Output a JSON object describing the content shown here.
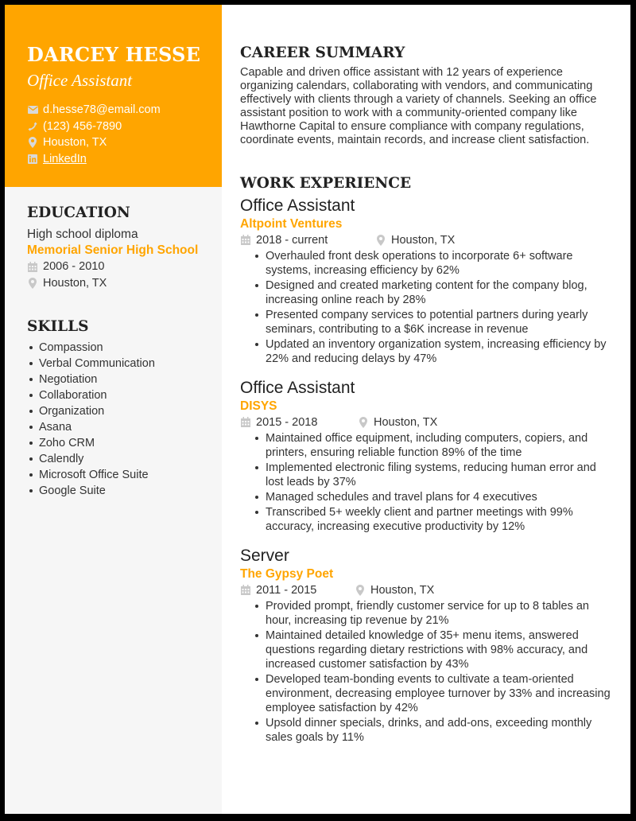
{
  "header": {
    "name": "DARCEY HESSE",
    "role": "Office Assistant",
    "contacts": {
      "email": "d.hesse78@email.com",
      "phone": "(123) 456-7890",
      "location": "Houston, TX",
      "linkedin": "LinkedIn"
    },
    "icons": [
      "envelope-icon",
      "phone-icon",
      "map-pin-icon",
      "linkedin-icon"
    ]
  },
  "colors": {
    "accent": "#ffa500",
    "sidebar_bg": "#f6f6f6",
    "text": "#333333",
    "heading": "#222222",
    "icon_gray": "#c8c8c8"
  },
  "education": {
    "title": "EDUCATION",
    "degree": "High school diploma",
    "school": "Memorial Senior High School",
    "dates": "2006 - 2010",
    "location": "Houston, TX"
  },
  "skills": {
    "title": "SKILLS",
    "items": [
      "Compassion",
      "Verbal Communication",
      "Negotiation",
      "Collaboration",
      "Organization",
      "Asana",
      "Zoho CRM",
      "Calendly",
      "Microsoft Office Suite",
      "Google Suite"
    ]
  },
  "summary": {
    "title": "CAREER SUMMARY",
    "text": "Capable and driven office assistant with 12 years of experience organizing calendars, collaborating with vendors, and communicating effectively with clients through a variety of channels. Seeking an office assistant position to work with a community-oriented company like Hawthorne Capital to ensure compliance with company regulations, coordinate events, maintain records, and increase client satisfaction."
  },
  "experience": {
    "title": "WORK EXPERIENCE",
    "jobs": [
      {
        "title": "Office Assistant",
        "company": "Altpoint Ventures",
        "dates": "2018 - current",
        "location": "Houston, TX",
        "bullets": [
          "Overhauled front desk operations to incorporate 6+ software systems, increasing efficiency by 62%",
          "Designed and created marketing content for the company blog, increasing online reach by 28%",
          "Presented company services to potential partners during yearly seminars, contributing to a $6K increase in revenue",
          "Updated an inventory organization system, increasing efficiency by 22% and reducing delays by 47%"
        ]
      },
      {
        "title": "Office Assistant",
        "company": "DISYS",
        "dates": "2015 - 2018",
        "location": "Houston, TX",
        "bullets": [
          "Maintained office equipment, including computers, copiers, and printers, ensuring reliable function 89% of the time",
          "Implemented electronic filing systems, reducing human error and lost leads by 37%",
          "Managed schedules and travel plans for 4 executives",
          "Transcribed 5+ weekly client and partner meetings with 99% accuracy, increasing executive productivity by 12%"
        ]
      },
      {
        "title": "Server",
        "company": "The Gypsy Poet",
        "dates": "2011 - 2015",
        "location": "Houston, TX",
        "bullets": [
          "Provided prompt, friendly customer service for up to 8 tables an hour, increasing tip revenue by 21%",
          "Maintained detailed knowledge of 35+ menu items, answered questions regarding dietary restrictions with 98% accuracy, and increased customer satisfaction by 43%",
          "Developed team-bonding events to cultivate a team-oriented environment, decreasing employee turnover by 33% and increasing employee satisfaction by 42%",
          "Upsold dinner specials, drinks, and add-ons, exceeding monthly sales goals by 11%"
        ]
      }
    ]
  }
}
